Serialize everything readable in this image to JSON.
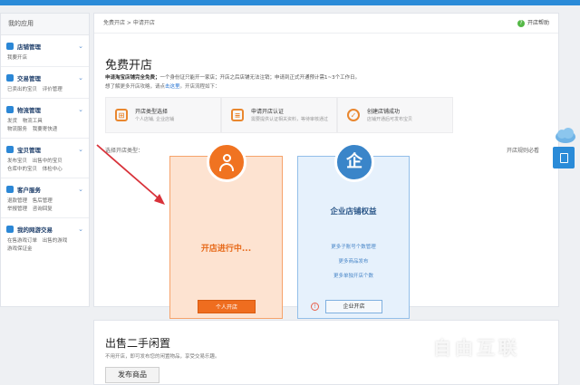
{
  "sidebar": {
    "header": "我的应用",
    "sections": [
      {
        "title": "店铺管理",
        "links": [
          "我要开店"
        ]
      },
      {
        "title": "交易管理",
        "links": [
          "已卖出的宝贝",
          "评价管理"
        ]
      },
      {
        "title": "物流管理",
        "links": [
          "发货",
          "物流工具",
          "物流服务",
          "我要寄快递"
        ]
      },
      {
        "title": "宝贝管理",
        "links": [
          "发布宝贝",
          "出售中的宝贝",
          "仓库中的宝贝",
          "体检中心"
        ]
      },
      {
        "title": "客户服务",
        "links": [
          "退款管理",
          "售后管理",
          "举报管理",
          "咨询回复"
        ]
      },
      {
        "title": "我的网游交易",
        "links": [
          "在售游戏订单",
          "出售的游戏",
          "游戏保证金"
        ]
      }
    ]
  },
  "main": {
    "breadcrumb": "免费开店 > 申请开店",
    "help_label": "开店帮助",
    "title": "免费开店",
    "notice_bold": "申请淘宝店铺完全免费；",
    "notice_rest": "一个身份证只能开一家店；开店之后店铺无法注销；申请到正式开通预计需1~3个工作日。",
    "more_prefix": "想了解更多开店攻略，请点",
    "more_link": "击这里",
    "more_suffix": "。开店流程如下：",
    "steps": [
      {
        "title": "开店类型选择",
        "desc": "个人店铺, 企业店铺"
      },
      {
        "title": "申请开店认证",
        "desc": "需要提供认证相关资料，等待审核通过"
      },
      {
        "title": "创建店铺成功",
        "desc": "店铺开通后可发布宝贝"
      }
    ],
    "choose_label": "选择开店类型：",
    "rules_label": "开店规则必看",
    "person_card": {
      "status": "开店进行中...",
      "button": "个人开店"
    },
    "corp_card": {
      "icon_char": "企",
      "title": "企业店铺权益",
      "benefits": [
        "更多子账号个数管理",
        "更多商品发布",
        "更多单独开店个数"
      ],
      "button": "企业开店"
    }
  },
  "secondhand": {
    "title": "出售二手闲置",
    "subtitle": "不用开店，即可发布您的闲置物品，享受交易乐趣。",
    "button": "发布商品"
  },
  "watermark": "自由互联",
  "colors": {
    "accent_blue": "#2a8bd8",
    "accent_orange": "#f07321"
  }
}
